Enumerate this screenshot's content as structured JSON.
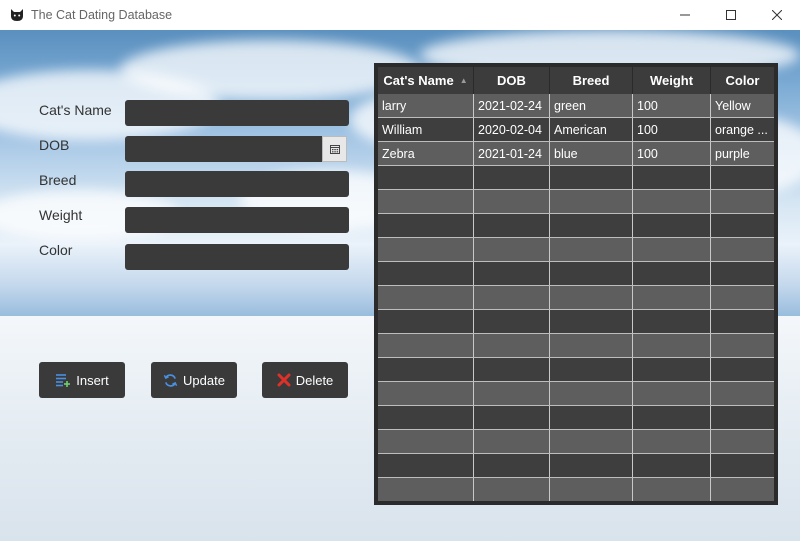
{
  "window": {
    "title": "The Cat Dating Database",
    "icon": "cat-icon"
  },
  "form": {
    "labels": {
      "name": "Cat's Name",
      "dob": "DOB",
      "breed": "Breed",
      "weight": "Weight",
      "color": "Color"
    },
    "values": {
      "name": "",
      "dob": "",
      "breed": "",
      "weight": "",
      "color": ""
    }
  },
  "buttons": {
    "insert": "Insert",
    "update": "Update",
    "delete": "Delete"
  },
  "table": {
    "columns": [
      "Cat's Name",
      "DOB",
      "Breed",
      "Weight",
      "Color"
    ],
    "sort_column": "Cat's Name",
    "rows": [
      [
        "larry",
        "2021-02-24",
        "green",
        "100",
        "Yellow"
      ],
      [
        "William",
        "2020-02-04",
        "American",
        "100",
        "orange ..."
      ],
      [
        "Zebra",
        "2021-01-24",
        "blue",
        "100",
        "purple"
      ]
    ]
  },
  "colors": {
    "field_bg": "#3a3a3a",
    "table_bg": "#2b2b2b",
    "delete_icon": "#e0302a",
    "insert_icon": "#2f7fd0"
  }
}
